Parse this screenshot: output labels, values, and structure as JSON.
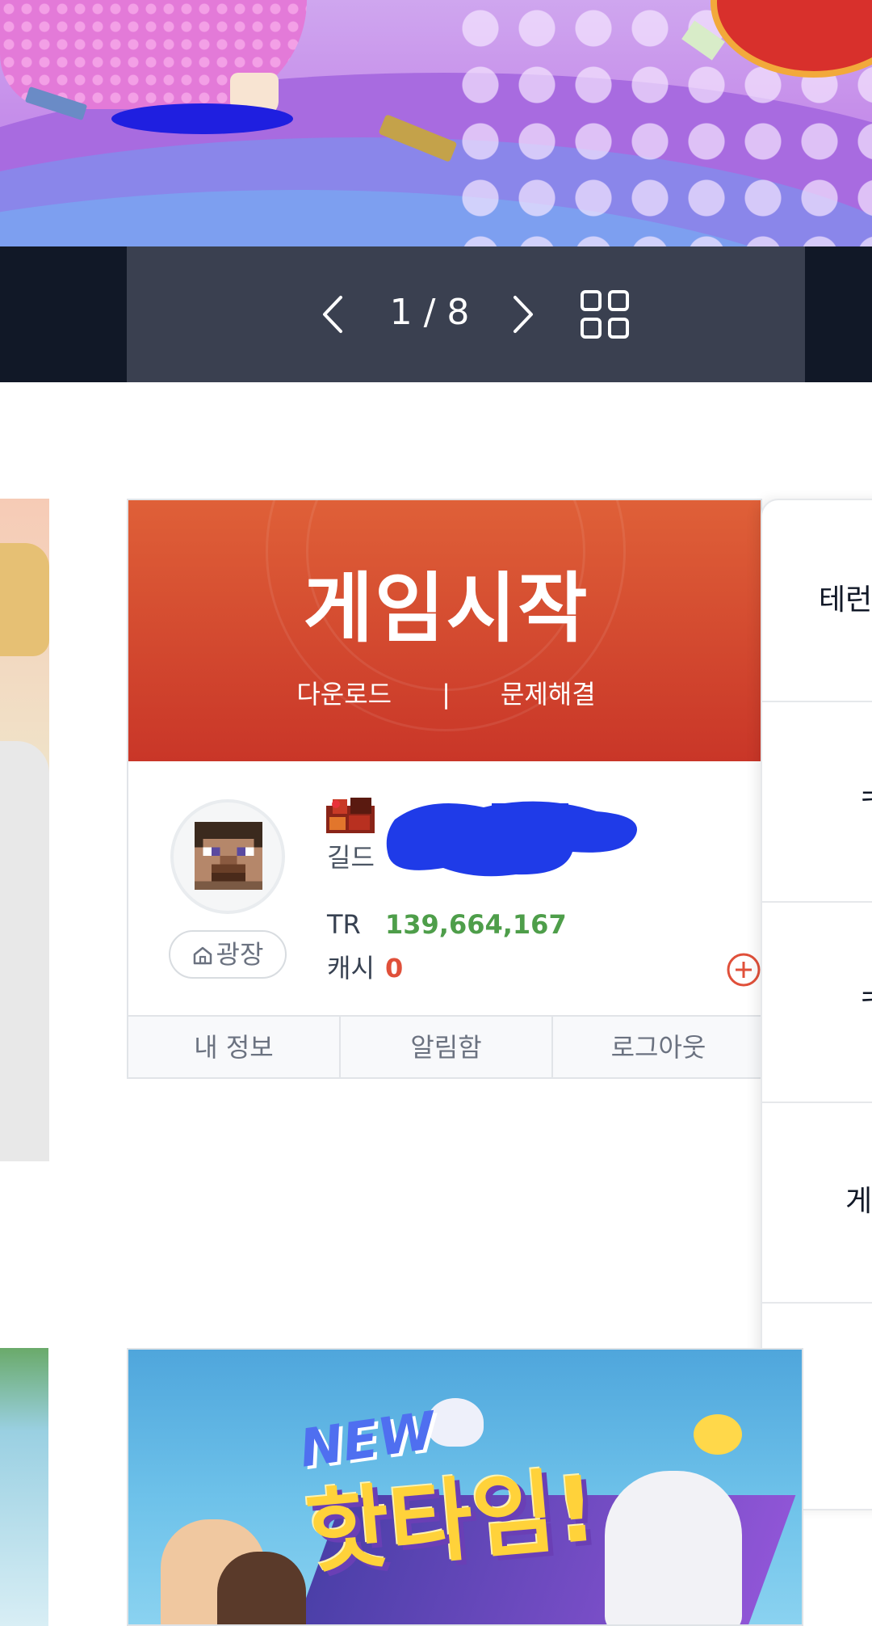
{
  "pager": {
    "counter": "1 / 8"
  },
  "game_card": {
    "title": "게임시작",
    "download_link": "다운로드",
    "separator": "|",
    "troubleshoot_link": "문제해결",
    "plaza_button": "광장",
    "guild_label": "길드",
    "tr_label": "TR",
    "tr_value": "139,664,167",
    "cash_label": "캐시",
    "cash_value": "0",
    "tabs": [
      "내 정보",
      "알림함",
      "로그아웃"
    ]
  },
  "side_panel": {
    "items": [
      "테런",
      "ㅋ",
      "ㅋ",
      "게"
    ]
  },
  "event_banner": {
    "new_label": "NEW",
    "title": "핫타임!"
  },
  "colors": {
    "banner_red": "#c93628",
    "tr_green": "#4e9e4a",
    "cash_red": "#e0503a",
    "pager_bg": "#3a4050"
  }
}
